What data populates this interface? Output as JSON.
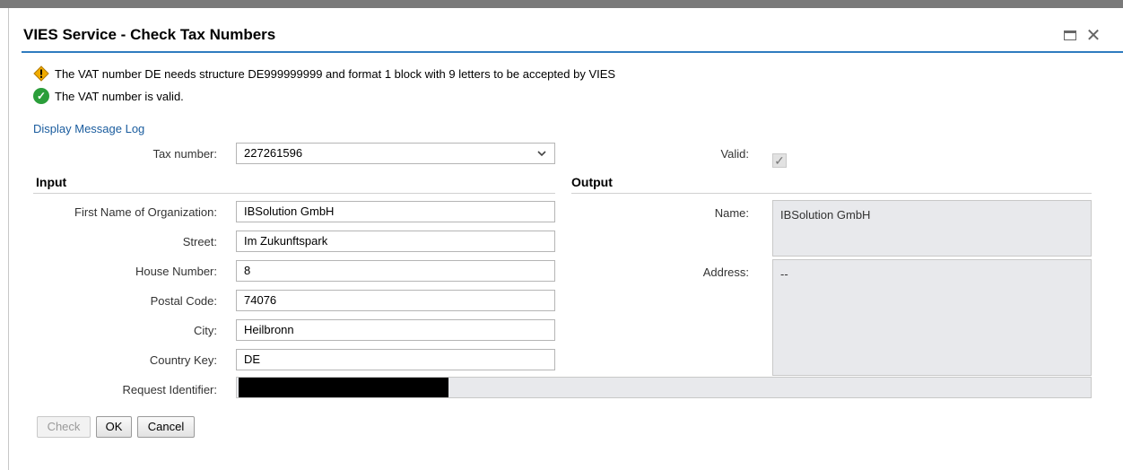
{
  "dialog": {
    "title": "VIES Service - Check Tax Numbers"
  },
  "messages": [
    {
      "type": "warning",
      "text": "The VAT number DE needs structure DE999999999 and format 1 block with 9 letters to be accepted by VIES"
    },
    {
      "type": "success",
      "text": "The VAT number is valid."
    }
  ],
  "links": {
    "message_log": "Display Message Log"
  },
  "tax": {
    "label": "Tax number:",
    "value": "227261596",
    "valid_label": "Valid:",
    "valid_checked": true
  },
  "input": {
    "heading": "Input",
    "fields": [
      {
        "label": "First Name of Organization:",
        "value": "IBSolution GmbH"
      },
      {
        "label": "Street:",
        "value": "Im Zukunftspark"
      },
      {
        "label": "House Number:",
        "value": "8"
      },
      {
        "label": "Postal Code:",
        "value": "74076"
      },
      {
        "label": "City:",
        "value": "Heilbronn"
      },
      {
        "label": "Country Key:",
        "value": "DE"
      }
    ],
    "request_identifier_label": "Request Identifier:"
  },
  "output": {
    "heading": "Output",
    "name_label": "Name:",
    "name_value": "IBSolution GmbH",
    "address_label": "Address:",
    "address_value": "--"
  },
  "buttons": {
    "check": "Check",
    "ok": "OK",
    "cancel": "Cancel"
  },
  "icons": {
    "warning": "warning-icon",
    "success": "check-circle-icon",
    "maximize": "maximize-icon",
    "close": "close-icon",
    "dropdown": "chevron-down-icon"
  },
  "colors": {
    "accent": "#2f7bbf",
    "link": "#1a5c9e",
    "success": "#2b9e3a",
    "warning": "#f0ab00"
  }
}
